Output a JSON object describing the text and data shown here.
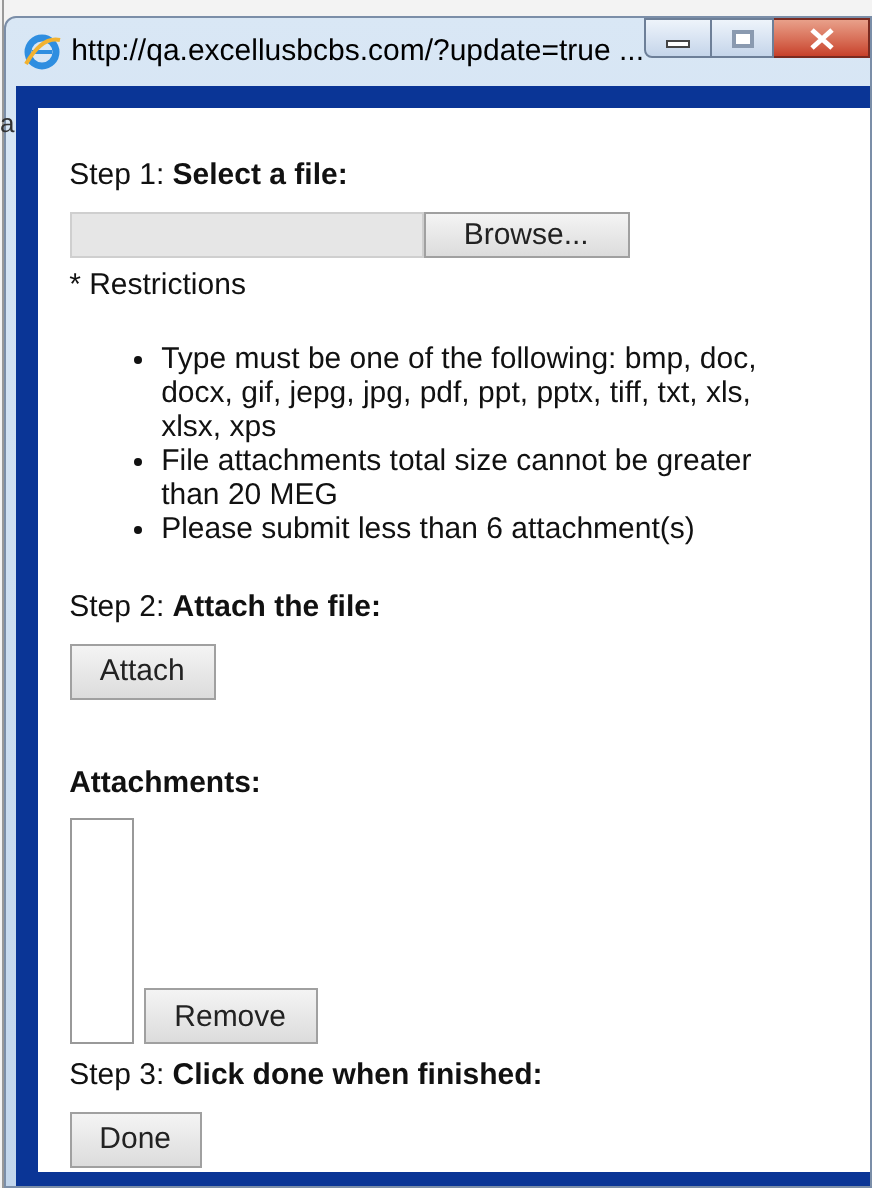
{
  "background_fragments": [
    "a"
  ],
  "window": {
    "title": "http://qa.excellusbcbs.com/?update=true ..."
  },
  "step1": {
    "label": "Step 1: **Select a file:**",
    "browse_button": "Browse...",
    "restrictions_title": "* Restrictions",
    "restrictions": [
      "Type must be one of the following: bmp, doc, docx, gif, jepg, jpg, pdf, ppt, pptx, tiff, txt, xls, xlsx, xps",
      "File attachments total size cannot be greater than 20 MEG",
      "Please submit less than 6 attachment(s)"
    ]
  },
  "step2": {
    "label": "Step 2: **Attach the file:**",
    "attach_button": "Attach"
  },
  "attachments": {
    "label": "Attachments:",
    "remove_button": "Remove"
  },
  "step3": {
    "label": "Step 3: **Click done when finished:**",
    "done_button": "Done"
  }
}
